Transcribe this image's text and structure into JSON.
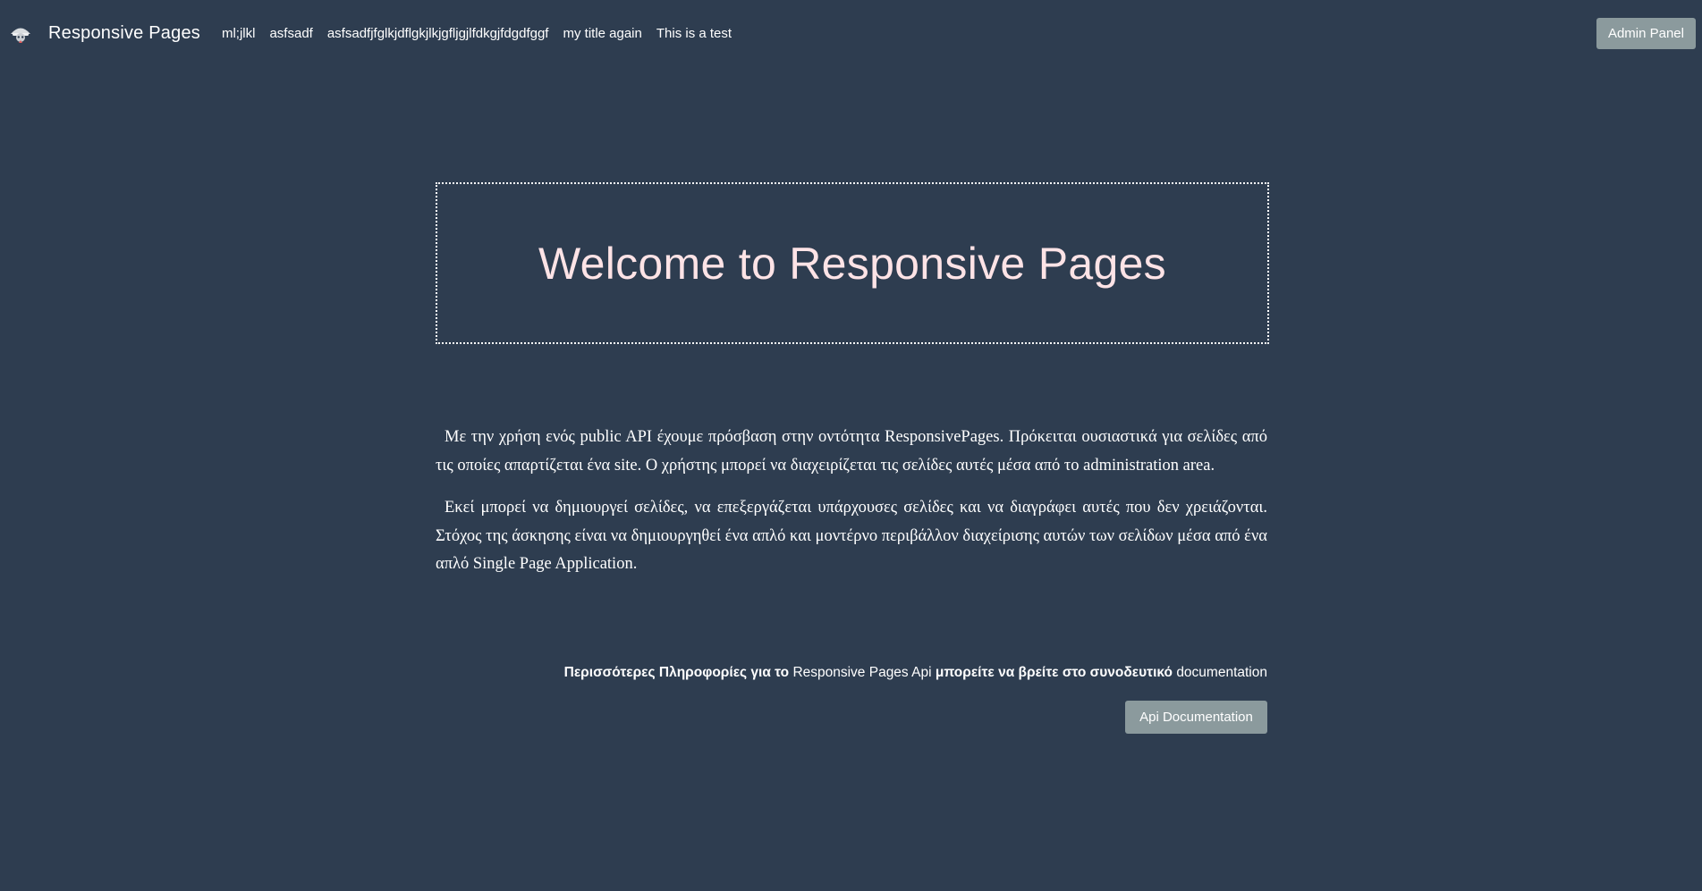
{
  "navbar": {
    "brand": "Responsive Pages",
    "links": [
      "ml;jlkl",
      "asfsadf",
      "asfsadfjfglkjdflgkjlkjgfljgjlfdkgjfdgdfggf",
      "my title again",
      "This is a test"
    ],
    "admin_button": "Admin Panel"
  },
  "hero": {
    "title": "Welcome to Responsive Pages"
  },
  "content": {
    "paragraph1": "Με την χρήση ενός public API έχουμε πρόσβαση στην οντότητα ResponsivePages. Πρόκειται ουσιαστικά για σελίδες από τις οποίες απαρτίζεται ένα site. Ο χρήστης μπορεί να διαχειρίζεται τις σελίδες αυτές μέσα από το administration area.",
    "paragraph2": "Εκεί μπορεί να δημιουργεί σελίδες, να επεξεργάζεται υπάρχουσες σελίδες και να διαγράφει αυτές που δεν χρειάζονται. Στόχος της άσκησης είναι να δημιουργηθεί ένα απλό και μοντέρνο περιβάλλον διαχείρισης αυτών των σελίδων μέσα από ένα απλό Single Page Application."
  },
  "more_info": {
    "part1": "Περισσότερες Πληροφορίες για το ",
    "part2": "Responsive Pages Api",
    "part3": " μπορείτε να βρείτε στο συνοδευτικό ",
    "part4": "documentation"
  },
  "api_button": "Api Documentation",
  "colors": {
    "background": "#2e3d50",
    "button": "#8b9a9d",
    "hero_title": "#fde3e6"
  },
  "icons": {
    "brand": "bot-logo-icon"
  }
}
